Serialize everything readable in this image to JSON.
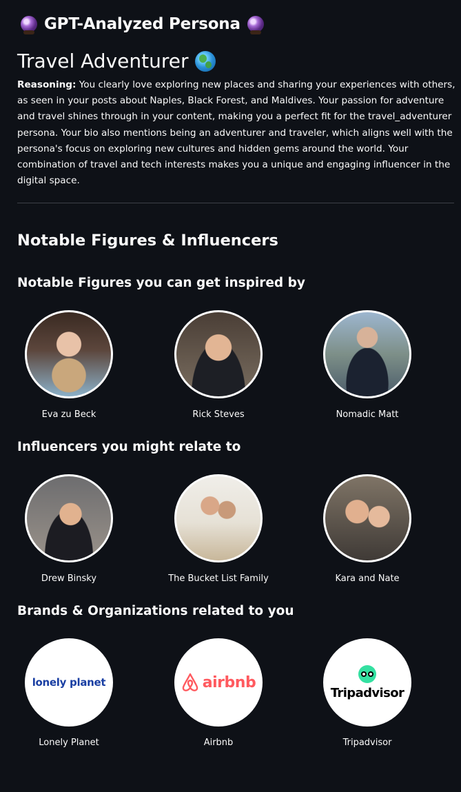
{
  "header": {
    "title": "GPT-Analyzed Persona",
    "icon": "crystal-ball-icon"
  },
  "persona": {
    "title": "Travel Adventurer",
    "icon": "globe-icon"
  },
  "reasoning": {
    "label": "Reasoning:",
    "text": " You clearly love exploring new places and sharing your experiences with others, as seen in your posts about Naples, Black Forest, and Maldives. Your passion for adventure and travel shines through in your content, making you a perfect fit for the travel_adventurer persona. Your bio also mentions being an adventurer and traveler, which aligns well with the persona's focus on exploring new cultures and hidden gems around the world. Your combination of travel and tech interests makes you a unique and engaging influencer in the digital space."
  },
  "sections": {
    "main_heading": "Notable Figures & Influencers",
    "notable_heading": "Notable Figures you can get inspired by",
    "influencers_heading": "Influencers you might relate to",
    "brands_heading": "Brands & Organizations related to you"
  },
  "notable_figures": [
    {
      "name": "Eva zu Beck"
    },
    {
      "name": "Rick Steves"
    },
    {
      "name": "Nomadic Matt"
    }
  ],
  "influencers": [
    {
      "name": "Drew Binsky"
    },
    {
      "name": "The Bucket List Family"
    },
    {
      "name": "Kara and Nate"
    }
  ],
  "brands": [
    {
      "name": "Lonely Planet",
      "logo_text": "lonely planet",
      "logo_color": "#1a3fa3"
    },
    {
      "name": "Airbnb",
      "logo_text": "airbnb",
      "logo_color": "#ff5a5f"
    },
    {
      "name": "Tripadvisor",
      "logo_text": "Tripadvisor",
      "logo_color": "#34e0a1"
    }
  ],
  "colors": {
    "background": "#0e1117",
    "text": "#fafafa",
    "divider": "#3d4048"
  }
}
